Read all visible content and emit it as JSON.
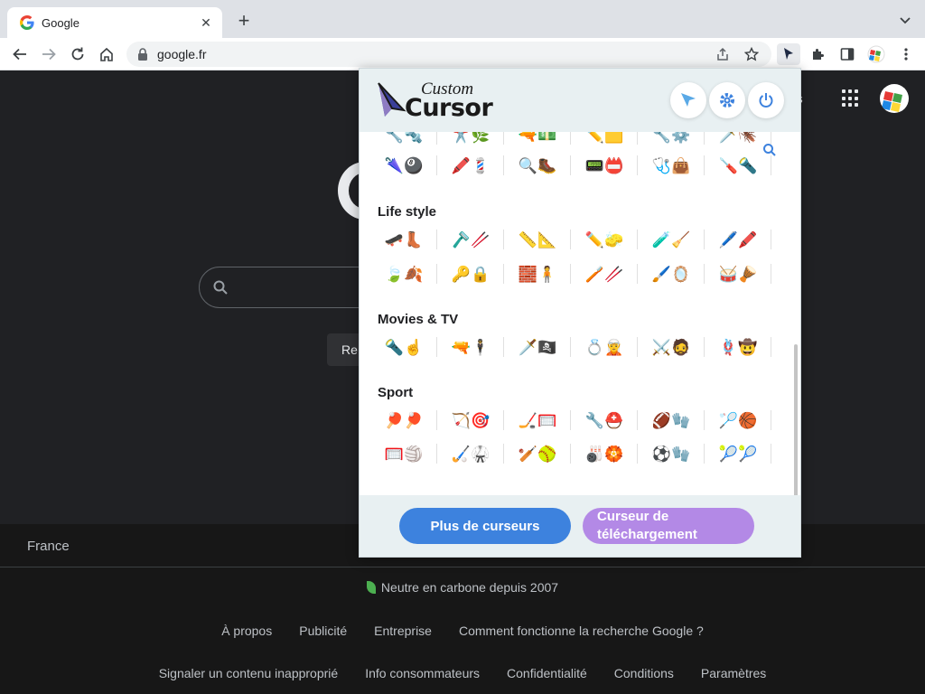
{
  "browser": {
    "tab_title": "Google",
    "url": "google.fr"
  },
  "google": {
    "images_label": "ges",
    "search_button_label": "Re",
    "country": "France",
    "carbon_text": "Neutre en carbone depuis 2007",
    "links_row1": [
      "À propos",
      "Publicité",
      "Entreprise",
      "Comment fonctionne la recherche Google ?"
    ],
    "links_row2": [
      "Signaler un contenu inapproprié",
      "Info consommateurs",
      "Confidentialité",
      "Conditions",
      "Paramètres"
    ]
  },
  "popup": {
    "logo_top": "Custom",
    "logo_bottom": "Cursor",
    "sections": {
      "lifestyle": "Life style",
      "movies": "Movies & TV",
      "sport": "Sport"
    },
    "rows": {
      "partial": [
        "🔧🔩",
        "✂️🌿",
        "🔫💵",
        "✏️🟨",
        "🔧⚙️",
        "🗡️🪳"
      ],
      "misc": [
        "🌂🎱",
        "🖍️💈",
        "🔍🥾",
        "📟📛",
        "🩺👜",
        "🪛🔦"
      ],
      "lifestyle1": [
        "🛹👢",
        "🪒🥢",
        "📏📐",
        "✏️🧽",
        "🧪🧹",
        "🖊️🖍️"
      ],
      "lifestyle2": [
        "🍃🍂",
        "🔑🔒",
        "🧱🧍",
        "🪥🥢",
        "🖌️🪞",
        "🥁🪘"
      ],
      "movies1": [
        "🔦☝️",
        "🔫🕴️",
        "🗡️🏴‍☠️",
        "💍🧝",
        "⚔️🧔",
        "🪢🤠"
      ],
      "sport1": [
        "🏓🏓",
        "🏹🎯",
        "🏒🥅",
        "🔧⛑️",
        "🏈🧤",
        "🏸🏀"
      ],
      "sport2": [
        "🥅🏐",
        "🏑🥋",
        "🏏🥎",
        "🎳🏵️",
        "⚽🧤",
        "🎾🎾"
      ]
    },
    "more_button": "Plus de curseurs",
    "upload_button": "Curseur de téléchargement"
  },
  "colors": {
    "primary_button": "#3d82de",
    "secondary_button": "#b389e6",
    "popup_header": "#e8f0f2"
  }
}
